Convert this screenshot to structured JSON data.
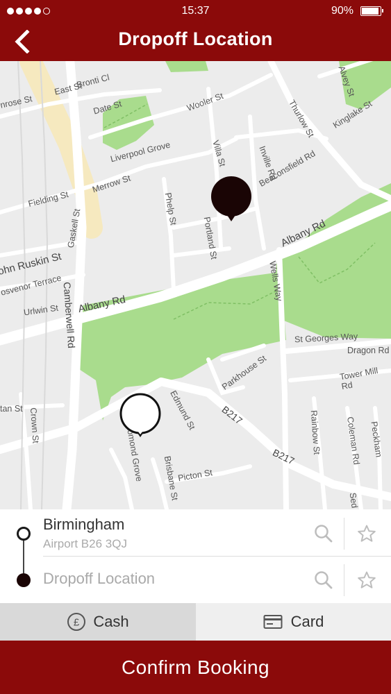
{
  "status_bar": {
    "time": "15:37",
    "battery_text": "90%",
    "battery_level": 0.9,
    "signal_dots_filled": 4,
    "signal_dots_total": 5
  },
  "header": {
    "title": "Dropoff Location",
    "back_icon": "chevron-left-icon"
  },
  "map": {
    "street_labels": [
      "East St",
      "Bronti Cl",
      "nrose St",
      "Date St",
      "Wooler St",
      "Thurlow St",
      "Kinglake St",
      "Liverpool Grove",
      "Villa St",
      "Inville Rd",
      "Beaconsfield Rd",
      "Merrow St",
      "Fielding St",
      "Gaskell St",
      "Phelp St",
      "Portland St",
      "Albany Rd",
      "ohn Ruskin St",
      "osvenor Terrace",
      "Urlwin St",
      "Camberwell Rd",
      "Wells Way",
      "St Georges Way",
      "Dragon Rd",
      "Tower Mill Rd",
      "Parkhouse St",
      "tan St",
      "Crown St",
      "Edmund St",
      "B217",
      "Lomond Grove",
      "Brisbane St",
      "Picton St",
      "Rainbow St",
      "Coleman Rd",
      "Peckham",
      "Sed",
      "Alvey St"
    ],
    "pickup_marker_icon": "map-pin-filled-icon",
    "dropoff_marker_icon": "map-pin-outline-icon"
  },
  "pickup": {
    "title": "Birmingham",
    "subtitle": "Airport B26 3QJ"
  },
  "dropoff": {
    "placeholder": "Dropoff Location"
  },
  "icons": {
    "search": "search-icon",
    "favorite": "star-icon",
    "cash": "pound-coin-icon",
    "card": "credit-card-icon"
  },
  "payment": {
    "cash_label": "Cash",
    "card_label": "Card",
    "selected": "cash"
  },
  "confirm_label": "Confirm Booking",
  "colors": {
    "brand": "#8b0a0a",
    "map_background": "#ececec",
    "park": "#a9dc8d",
    "main_road": "#ffffff",
    "highlight_road": "#f6e9bf"
  }
}
